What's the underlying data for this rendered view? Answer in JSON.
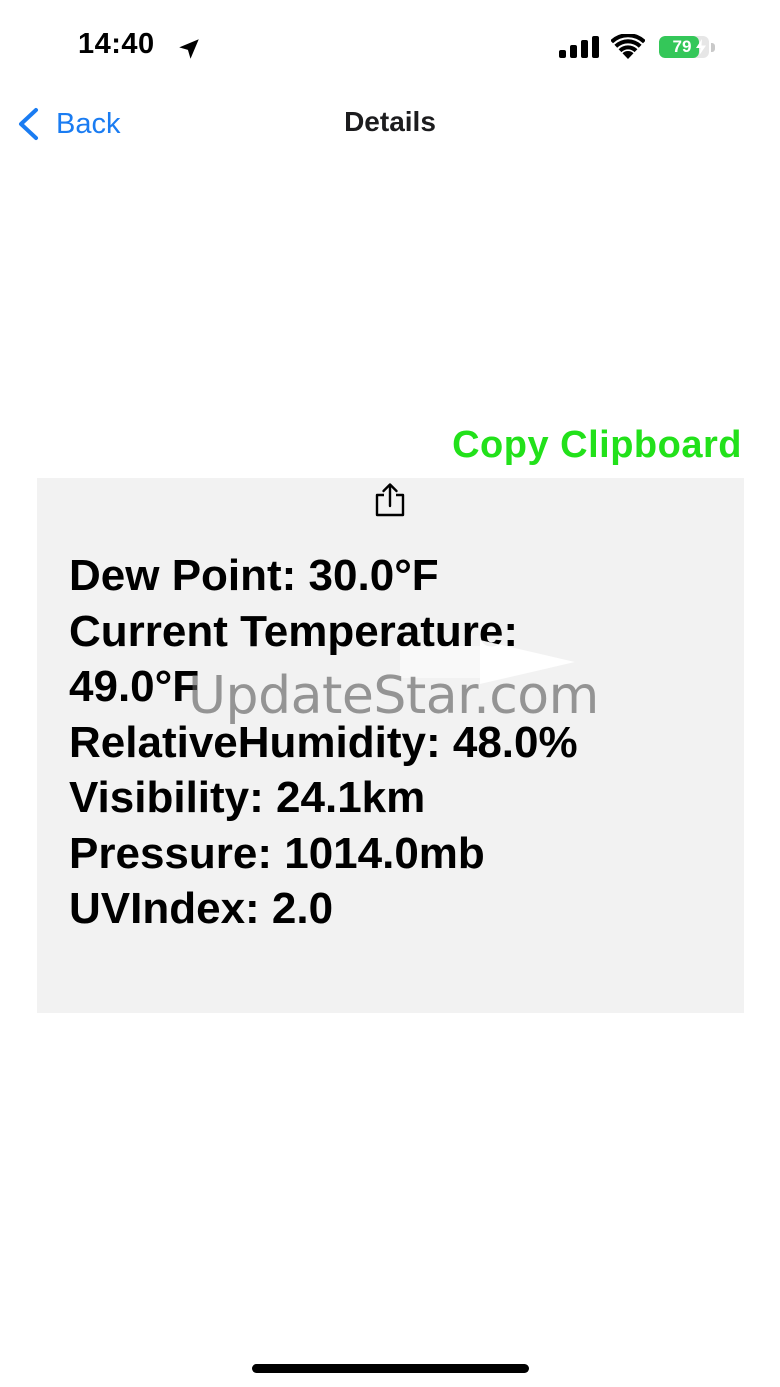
{
  "status_bar": {
    "time": "14:40",
    "battery_percent": 79,
    "battery_label": "79",
    "charging": true
  },
  "nav": {
    "back_label": "Back",
    "title": "Details"
  },
  "copy_button": {
    "label": "Copy Clipboard",
    "color": "#22e11a"
  },
  "weather": {
    "lines": [
      "Dew Point: 30.0°F",
      "Current Temperature:",
      "49.0°F",
      "RelativeHumidity: 48.0%",
      "Visibility: 24.1km",
      "Pressure: 1014.0mb",
      "UVIndex: 2.0"
    ]
  },
  "watermark": {
    "text": "UpdateStar.com"
  },
  "colors": {
    "accent_blue": "#1a7cf2",
    "battery_green": "#34c759",
    "panel_gray": "#f2f2f2"
  },
  "icons": {
    "location": "location-arrow-icon",
    "signal": "cellular-signal-icon",
    "wifi": "wifi-icon",
    "share": "share-icon",
    "back": "chevron-left-icon"
  }
}
